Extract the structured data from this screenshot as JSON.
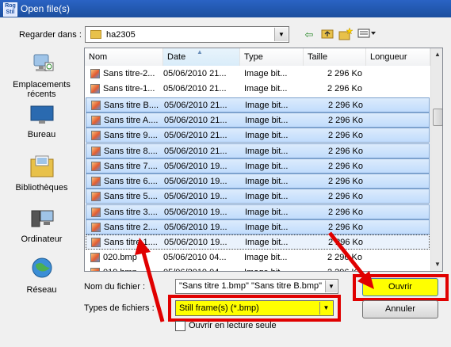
{
  "window": {
    "title": "Open file(s)",
    "app_icon_text": "Rog Stil"
  },
  "look_in": {
    "label": "Regarder dans :",
    "value": "ha2305"
  },
  "toolbar": {
    "back": "back-icon",
    "up": "up-folder-icon",
    "new_folder": "new-folder-icon",
    "views": "views-menu-icon"
  },
  "places": [
    {
      "label": "Emplacements récents",
      "icon": "recent-places-icon"
    },
    {
      "label": "Bureau",
      "icon": "desktop-icon"
    },
    {
      "label": "Bibliothèques",
      "icon": "libraries-icon"
    },
    {
      "label": "Ordinateur",
      "icon": "computer-icon"
    },
    {
      "label": "Réseau",
      "icon": "network-icon"
    }
  ],
  "columns": [
    "Nom",
    "Date",
    "Type",
    "Taille",
    "Longueur"
  ],
  "files": [
    {
      "name": "Sans titre-2...",
      "date": "05/06/2010 21...",
      "type": "Image bit...",
      "size": "2 296 Ko",
      "selected": false
    },
    {
      "name": "Sans titre-1...",
      "date": "05/06/2010 21...",
      "type": "Image bit...",
      "size": "2 296 Ko",
      "selected": false
    },
    {
      "name": "Sans titre B....",
      "date": "05/06/2010 21...",
      "type": "Image bit...",
      "size": "2 296 Ko",
      "selected": true
    },
    {
      "name": "Sans titre A....",
      "date": "05/06/2010 21...",
      "type": "Image bit...",
      "size": "2 296 Ko",
      "selected": true
    },
    {
      "name": "Sans titre 9....",
      "date": "05/06/2010 21...",
      "type": "Image bit...",
      "size": "2 296 Ko",
      "selected": true
    },
    {
      "name": "Sans titre 8....",
      "date": "05/06/2010 21...",
      "type": "Image bit...",
      "size": "2 296 Ko",
      "selected": true
    },
    {
      "name": "Sans titre 7....",
      "date": "05/06/2010 19...",
      "type": "Image bit...",
      "size": "2 296 Ko",
      "selected": true
    },
    {
      "name": "Sans titre 6....",
      "date": "05/06/2010 19...",
      "type": "Image bit...",
      "size": "2 296 Ko",
      "selected": true
    },
    {
      "name": "Sans titre 5....",
      "date": "05/06/2010 19...",
      "type": "Image bit...",
      "size": "2 296 Ko",
      "selected": true
    },
    {
      "name": "Sans titre 3....",
      "date": "05/06/2010 19...",
      "type": "Image bit...",
      "size": "2 296 Ko",
      "selected": true
    },
    {
      "name": "Sans titre 2....",
      "date": "05/06/2010 19...",
      "type": "Image bit...",
      "size": "2 296 Ko",
      "selected": true
    },
    {
      "name": "Sans titre 1....",
      "date": "05/06/2010 19...",
      "type": "Image bit...",
      "size": "2 296 Ko",
      "selected": true,
      "focused": true
    },
    {
      "name": "020.bmp",
      "date": "05/06/2010 04...",
      "type": "Image bit...",
      "size": "2 296 Ko",
      "selected": false
    },
    {
      "name": "019.bmp",
      "date": "05/06/2010 04...",
      "type": "Image bit...",
      "size": "2 296 Ko",
      "selected": false
    }
  ],
  "filename": {
    "label": "Nom du fichier :",
    "value": "\"Sans titre 1.bmp\" \"Sans titre B.bmp\" \"S"
  },
  "filetype": {
    "label": "Types de fichiers :",
    "value": "Still frame(s) (*.bmp)"
  },
  "readonly": {
    "label": "Ouvrir en lecture seule",
    "checked": false
  },
  "buttons": {
    "open": "Ouvrir",
    "cancel": "Annuler"
  },
  "colors": {
    "highlight": "#e00000",
    "highlight_fill": "#ffff00",
    "selection": "#cce0fb"
  }
}
